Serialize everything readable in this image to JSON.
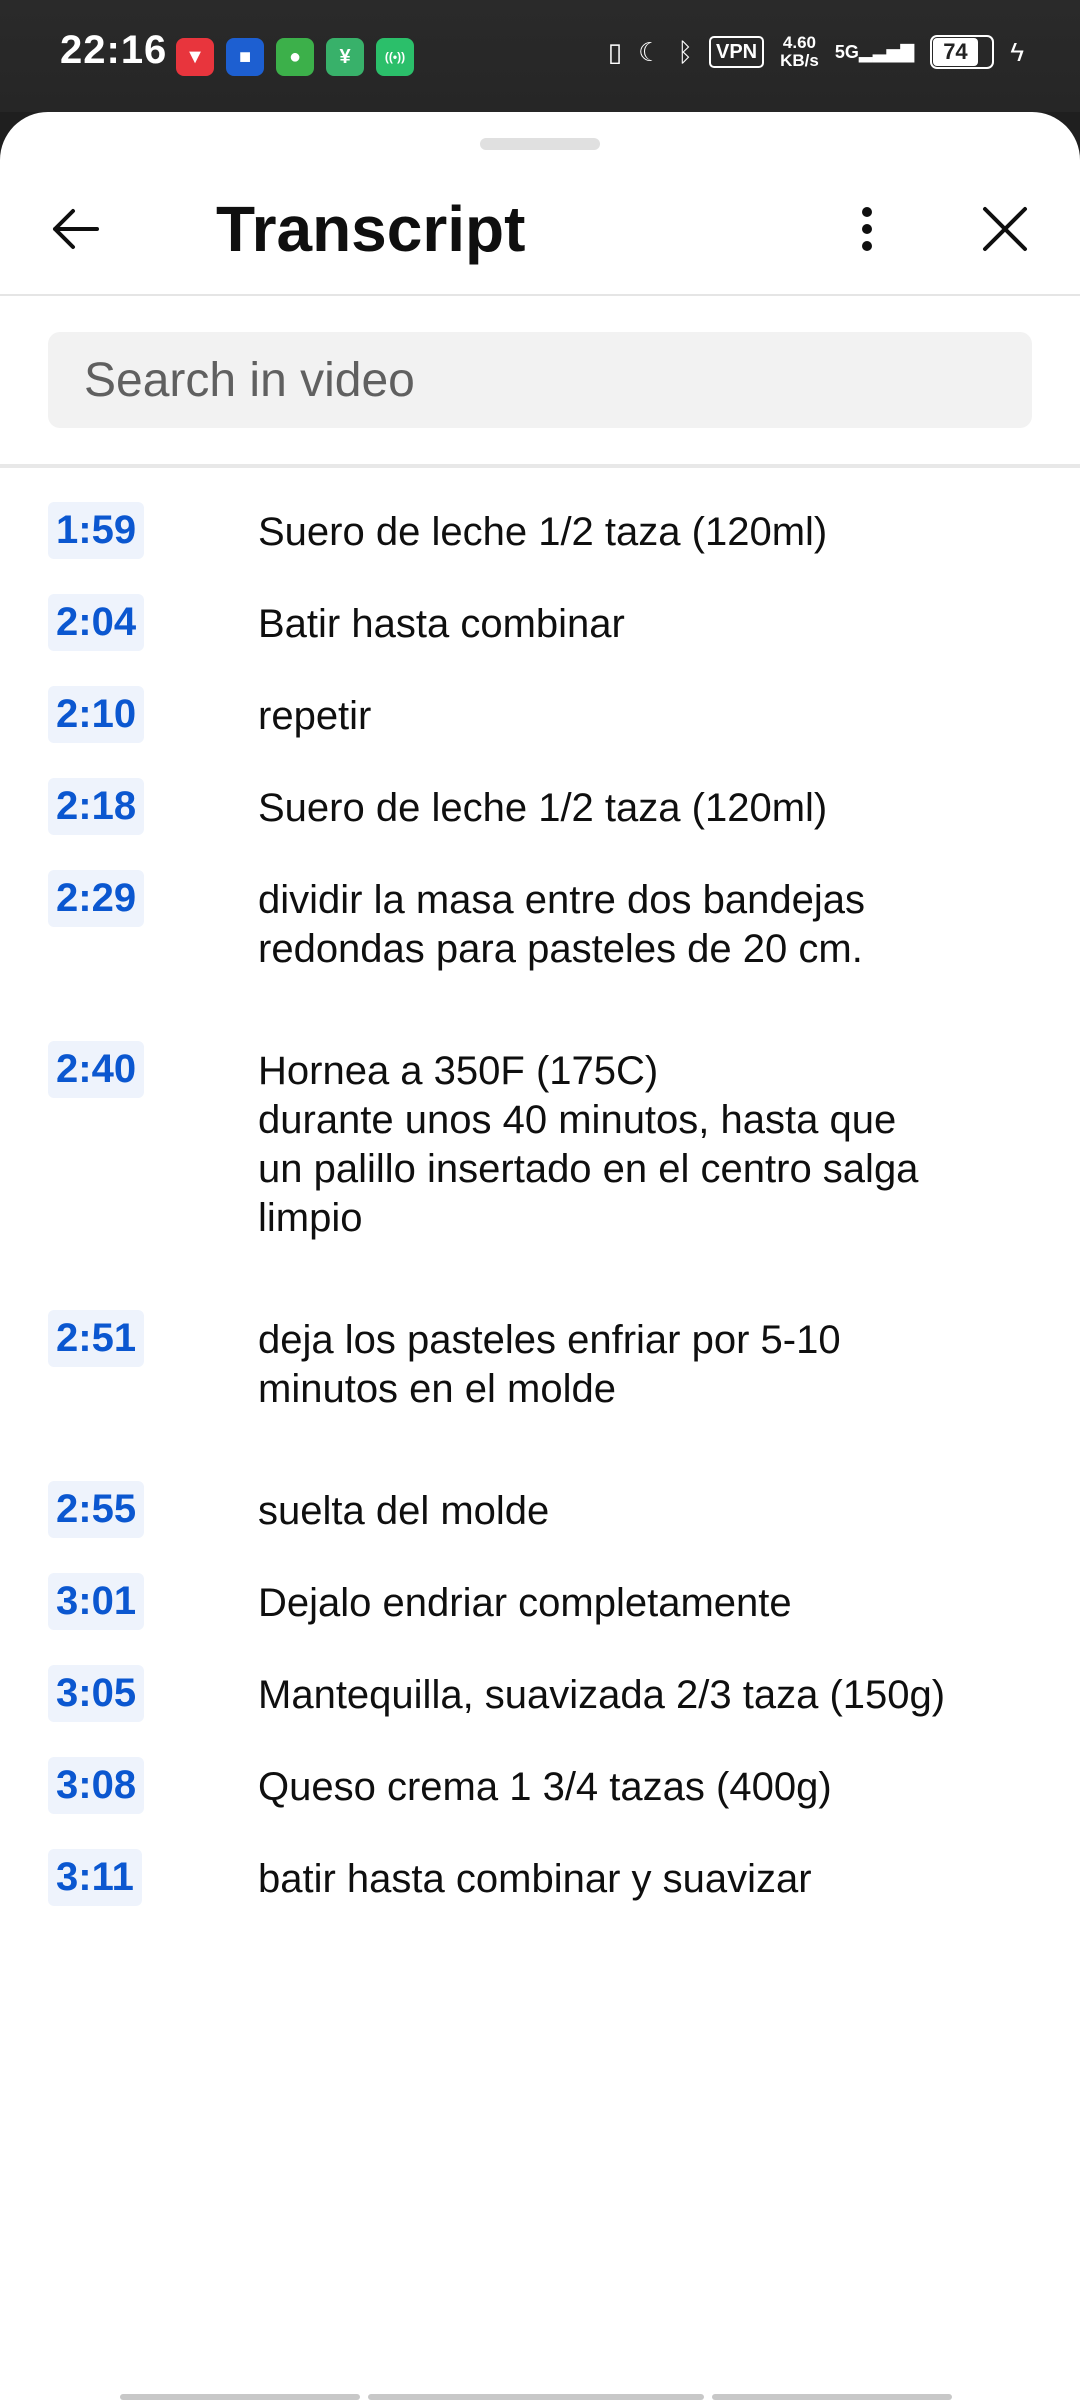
{
  "status_bar": {
    "time": "22:16",
    "apps": [
      {
        "icon": "app-red-icon",
        "color": "#e8353d",
        "glyph": "▼"
      },
      {
        "icon": "app-blue-icon",
        "color": "#1d5fd1",
        "glyph": "■"
      },
      {
        "icon": "chrome-icon",
        "color": "#3cb04a",
        "glyph": "●"
      },
      {
        "icon": "app-green-icon",
        "color": "#38b16a",
        "glyph": "¥"
      },
      {
        "icon": "hotspot-icon",
        "color": "#2bbf6a",
        "glyph": "((•))"
      }
    ],
    "vpn": "VPN",
    "speed": "4.60",
    "speed_unit": "KB/s",
    "network": "5G",
    "battery": "74"
  },
  "header": {
    "title": "Transcript"
  },
  "search": {
    "placeholder": "Search in video"
  },
  "transcript": [
    {
      "time": "1:59",
      "text": "Suero de leche 1/2 taza (120ml)"
    },
    {
      "time": "2:04",
      "text": "Batir hasta combinar"
    },
    {
      "time": "2:10",
      "text": "repetir"
    },
    {
      "time": "2:18",
      "text": "Suero de leche 1/2 taza (120ml)"
    },
    {
      "time": "2:29",
      "text": "dividir la masa entre dos bandejas\nredondas para pasteles de 20 cm."
    },
    {
      "time": "2:40",
      "text": "Hornea a 350F (175C)\ndurante unos 40 minutos, hasta que\nun palillo insertado en el centro salga\nlimpio"
    },
    {
      "time": "2:51",
      "text": "deja los pasteles enfriar por 5-10\nminutos en el molde"
    },
    {
      "time": "2:55",
      "text": "suelta del molde"
    },
    {
      "time": "3:01",
      "text": "Dejalo endriar completamente"
    },
    {
      "time": "3:05",
      "text": "Mantequilla, suavizada 2/3 taza (150g)"
    },
    {
      "time": "3:08",
      "text": "Queso crema 1 3/4 tazas (400g)"
    },
    {
      "time": "3:11",
      "text": "batir hasta combinar y suavizar"
    }
  ],
  "colors": {
    "accent": "#0b57d0",
    "timestamp_bg": "#eef3fc"
  }
}
